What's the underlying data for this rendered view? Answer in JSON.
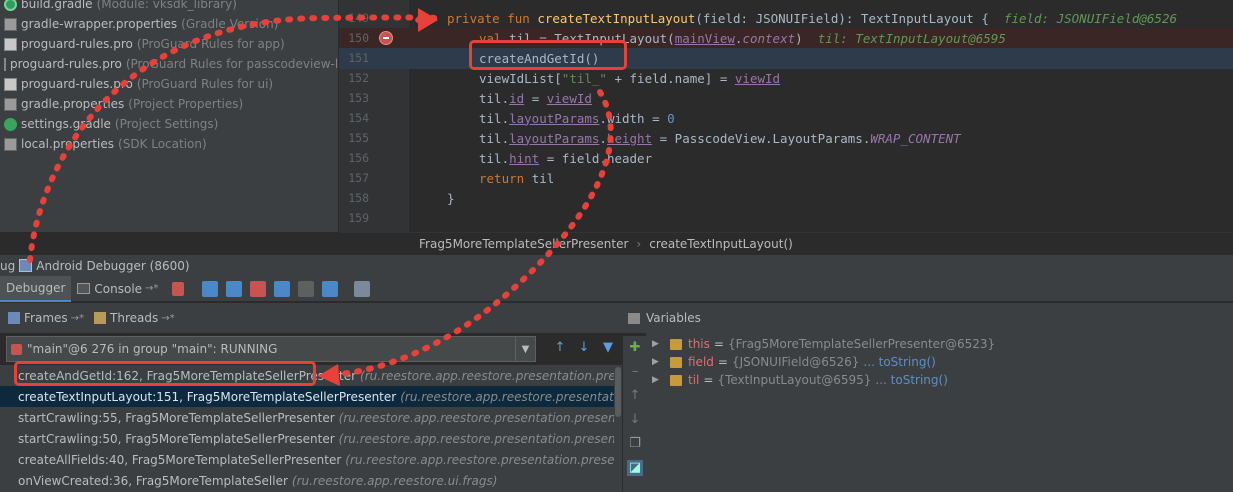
{
  "project_tree": [
    {
      "name": "build.gradle",
      "hint": "(Module: vksdk_library)",
      "icon": "gradle-icon"
    },
    {
      "name": "gradle-wrapper.properties",
      "hint": "(Gradle Version)",
      "icon": "properties-file-icon"
    },
    {
      "name": "proguard-rules.pro",
      "hint": "(ProGuard Rules for app)",
      "icon": "file-icon"
    },
    {
      "name": "proguard-rules.pro",
      "hint": "(ProGuard Rules for passcodeview-libr",
      "icon": "file-icon"
    },
    {
      "name": "proguard-rules.pro",
      "hint": "(ProGuard Rules for ui)",
      "icon": "file-icon"
    },
    {
      "name": "gradle.properties",
      "hint": "(Project Properties)",
      "icon": "properties-file-icon"
    },
    {
      "name": "settings.gradle",
      "hint": "(Project Settings)",
      "icon": "gradle-icon"
    },
    {
      "name": "local.properties",
      "hint": "(SDK Location)",
      "icon": "properties-file-icon"
    }
  ],
  "editor": {
    "line_numbers": [
      "149",
      "150",
      "151",
      "152",
      "153",
      "154",
      "155",
      "156",
      "157",
      "158",
      "159"
    ],
    "lines": {
      "l149_kw1": "private fun ",
      "l149_fn": "createTextInputLayout",
      "l149_rest": "(field: JSONUIField): TextInputLayout {",
      "l149_hint": "field: JSONUIField@6526",
      "l150_kw": "val ",
      "l150_rest1": "til = TextInputLayout(",
      "l150_mv": "mainView",
      "l150_dot": ".",
      "l150_ctx": "context",
      "l150_close": ")",
      "l150_hint": "til: TextInputLayout@6595",
      "l151": "createAndGetId()",
      "l152_a": "viewIdList[",
      "l152_str": "\"til_\"",
      "l152_b": " + field.name] = ",
      "l152_c": "viewId",
      "l153_a": "til.",
      "l153_b": "id",
      "l153_c": " = ",
      "l153_d": "viewId",
      "l154_a": "til.",
      "l154_b": "layoutParams",
      "l154_c": ".width = ",
      "l154_d": "0",
      "l155_a": "til.",
      "l155_b": "layoutParams",
      "l155_c": ".",
      "l155_d": "height",
      "l155_e": " = PasscodeView.LayoutParams.",
      "l155_f": "WRAP_CONTENT",
      "l156_a": "til.",
      "l156_b": "hint",
      "l156_c": " = field.header",
      "l157_kw": "return ",
      "l157_rest": "til",
      "l158": "}"
    }
  },
  "breadcrumb": {
    "class_name": "Frag5MoreTemplateSellerPresenter",
    "sep": "›",
    "method_name": "createTextInputLayout()"
  },
  "debug_title": "ug",
  "debug_session": "Android Debugger (8600)",
  "tabs": {
    "debugger": "Debugger",
    "console": "Console",
    "console_suffix": "→*"
  },
  "frames_tab": {
    "frames": "Frames",
    "frames_suffix": "→*",
    "threads": "Threads",
    "threads_suffix": "→*"
  },
  "thread_selector": "\"main\"@6 276 in group \"main\": RUNNING",
  "frames": [
    {
      "name": "createAndGetId:162, Frag5MoreTemplateSellerPresenter",
      "pkg": "(ru.reestore.app.reestore.presentation.presenter.frags)"
    },
    {
      "name": "createTextInputLayout:151, Frag5MoreTemplateSellerPresenter",
      "pkg": "(ru.reestore.app.reestore.presentation.presenter.frag"
    },
    {
      "name": "startCrawling:55, Frag5MoreTemplateSellerPresenter",
      "pkg": "(ru.reestore.app.reestore.presentation.presenter.frags)"
    },
    {
      "name": "startCrawling:50, Frag5MoreTemplateSellerPresenter",
      "pkg": "(ru.reestore.app.reestore.presentation.presenter.frags)"
    },
    {
      "name": "createAllFields:40, Frag5MoreTemplateSellerPresenter",
      "pkg": "(ru.reestore.app.reestore.presentation.presenter.frags)"
    },
    {
      "name": "onViewCreated:36, Frag5MoreTemplateSeller",
      "pkg": "(ru.reestore.app.reestore.ui.frags)"
    }
  ],
  "variables_title": "Variables",
  "variables": [
    {
      "name": "this",
      "value": "{Frag5MoreTemplateSellerPresenter@6523}",
      "link": ""
    },
    {
      "name": "field",
      "value": "{JSONUIField@6526}",
      "link": "... toString()"
    },
    {
      "name": "til",
      "value": "{TextInputLayout@6595}",
      "link": "... toString()"
    }
  ],
  "colors": {
    "annotation_red": "#e8413a",
    "selected_row": "#0d293e"
  }
}
